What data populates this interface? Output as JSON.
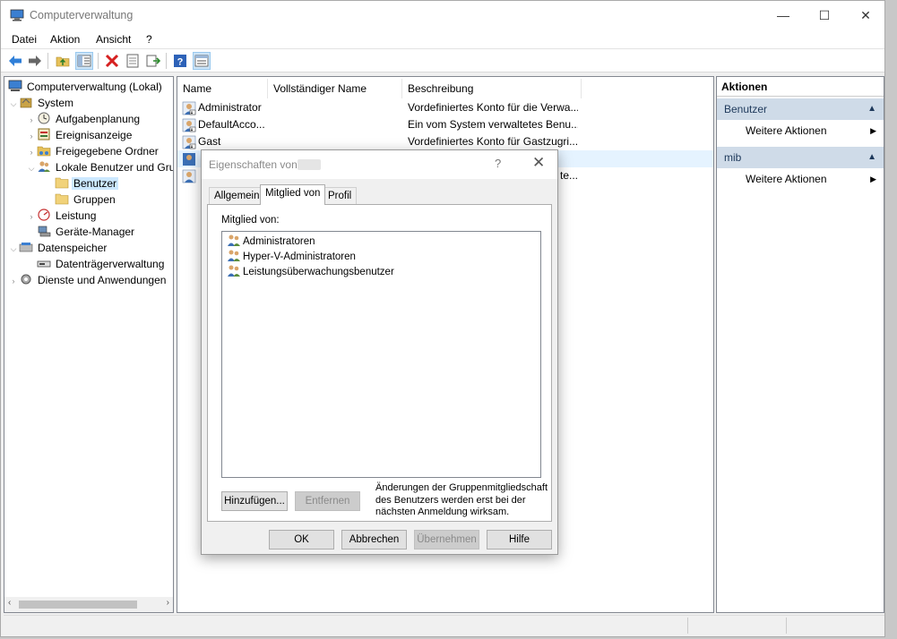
{
  "window": {
    "title": "Computerverwaltung",
    "controls": {
      "minimize": "—",
      "maximize": "☐",
      "close": "✕"
    }
  },
  "menu": [
    "Datei",
    "Aktion",
    "Ansicht",
    "?"
  ],
  "toolbar": [
    "back-icon",
    "forward-icon",
    "up-folder-icon",
    "show-tree-icon",
    "delete-icon",
    "properties-icon",
    "export-icon",
    "help-icon",
    "view-icon"
  ],
  "tree": {
    "root": "Computerverwaltung (Lokal)",
    "system": "System",
    "aufgabenplanung": "Aufgabenplanung",
    "ereignisanzeige": "Ereignisanzeige",
    "freigegebene_ordner": "Freigegebene Ordner",
    "lokale_benutzer": "Lokale Benutzer und Gru",
    "benutzer": "Benutzer",
    "gruppen": "Gruppen",
    "leistung": "Leistung",
    "geraete_manager": "Geräte-Manager",
    "datenspeicher": "Datenspeicher",
    "datentraeger": "Datenträgerverwaltung",
    "dienste": "Dienste und Anwendungen"
  },
  "list": {
    "columns": [
      "Name",
      "Vollständiger Name",
      "Beschreibung"
    ],
    "rows": [
      {
        "name": "Administrator",
        "fullname": "",
        "desc": "Vordefiniertes Konto für die Verwa..."
      },
      {
        "name": "DefaultAcco...",
        "fullname": "",
        "desc": "Ein vom System verwaltetes Benu..."
      },
      {
        "name": "Gast",
        "fullname": "",
        "desc": "Vordefiniertes Konto für Gastzugri..."
      },
      {
        "name": "",
        "fullname": "",
        "desc": ""
      },
      {
        "name": "",
        "fullname": "",
        "desc": "te..."
      }
    ]
  },
  "actions": {
    "header": "Aktionen",
    "sections": [
      {
        "title": "Benutzer",
        "item": "Weitere Aktionen"
      },
      {
        "title": "mib",
        "item": "Weitere Aktionen"
      }
    ]
  },
  "dialog": {
    "title": "Eigenschaften von",
    "help": "?",
    "close": "✕",
    "tabs": [
      "Allgemein",
      "Mitglied von",
      "Profil"
    ],
    "member_label": "Mitglied von:",
    "groups": [
      "Administratoren",
      "Hyper-V-Administratoren",
      "Leistungsüberwachungsbenutzer"
    ],
    "add_button": "Hinzufügen...",
    "remove_button": "Entfernen",
    "note": "Änderungen der Gruppenmitgliedschaft des Benutzers werden erst bei der nächsten Anmeldung wirksam.",
    "ok": "OK",
    "cancel": "Abbrechen",
    "apply": "Übernehmen",
    "help_button": "Hilfe"
  }
}
